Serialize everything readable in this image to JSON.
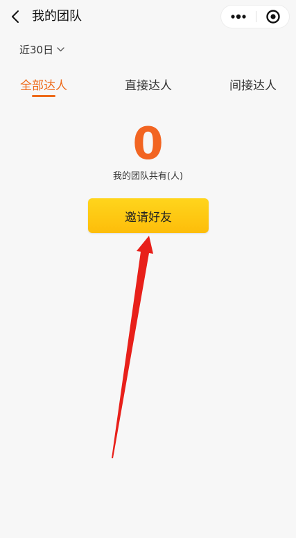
{
  "header": {
    "title": "我的团队",
    "back_icon": "chevron-left-icon",
    "more_icon": "more-dots-icon",
    "close_icon": "target-close-icon"
  },
  "date_filter": {
    "label": "近30日",
    "icon": "chevron-down-icon"
  },
  "tabs": [
    {
      "label": "全部达人",
      "active": true
    },
    {
      "label": "直接达人",
      "active": false
    },
    {
      "label": "间接达人",
      "active": false
    }
  ],
  "stats": {
    "team_count": "0",
    "caption": "我的团队共有(人)"
  },
  "invite_button": {
    "label": "邀请好友"
  },
  "annotation": {
    "type": "arrow",
    "color": "#e8201a",
    "points_to": "invite_button"
  },
  "colors": {
    "accent": "#ee6a1a",
    "count": "#f26522",
    "button": "#ffd51c",
    "background": "#f7f7f7"
  }
}
